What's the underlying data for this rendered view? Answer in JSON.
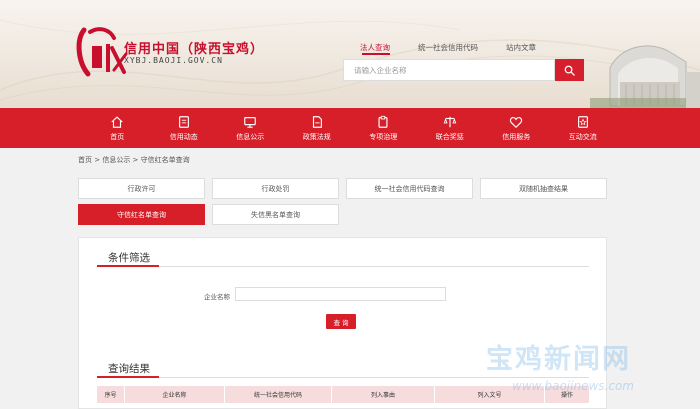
{
  "header": {
    "site_title": "信用中国（陕西宝鸡）",
    "site_domain": "XYBJ.BAOJI.GOV.CN",
    "search_tabs": [
      "法人查询",
      "统一社会信用代码",
      "站内文章"
    ],
    "search_placeholder": "请输入企业名称"
  },
  "nav": {
    "items": [
      "首页",
      "信用动态",
      "信息公示",
      "政策法规",
      "专项治理",
      "联合奖惩",
      "信用服务",
      "互动交流"
    ]
  },
  "breadcrumb": "首页 > 信息公示 > 守信红名单查询",
  "filter_tabs": {
    "row1": [
      "行政许可",
      "行政处罚",
      "统一社会信用代码查询",
      "双随机抽查结果"
    ],
    "row2": [
      "守信红名单查询",
      "失信黑名单查询"
    ]
  },
  "conditions": {
    "title": "条件筛选",
    "company_label": "企业名称",
    "query_button": "查 询"
  },
  "results": {
    "title": "查询结果",
    "columns": [
      "序号",
      "企业名称",
      "统一社会信用代码",
      "列入事由",
      "列入文号",
      "操作"
    ]
  },
  "watermark": {
    "text": "宝鸡新闻网",
    "url": "www.baojinews.com"
  },
  "colors": {
    "brand_red": "#d71f2a",
    "table_head": "#f6dcdc"
  }
}
